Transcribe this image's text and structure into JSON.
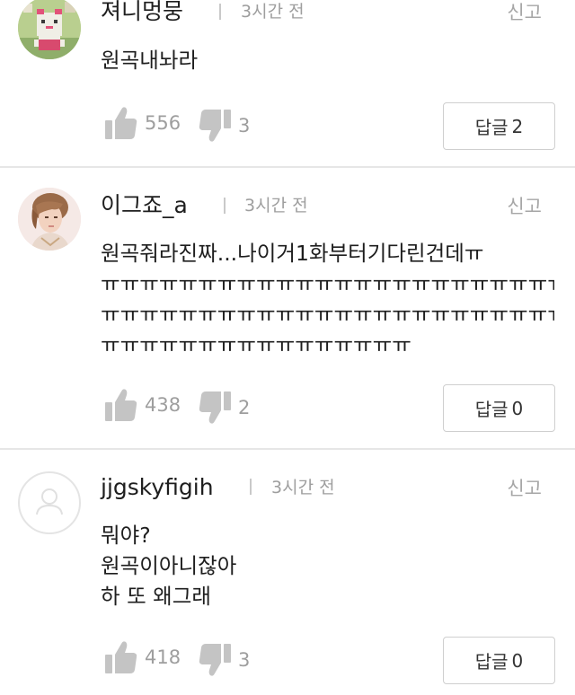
{
  "colors": {
    "text": "#1e1e1e",
    "meta": "#9e9e9e",
    "icon": "#c4c4c4",
    "divider": "#e6e6e6",
    "button_border": "#cfcfcf"
  },
  "comments": [
    {
      "username": "져니멍뭉",
      "time": "3시간 전",
      "report": "신고",
      "lines": [
        "원곡내놔라"
      ],
      "likes": "556",
      "dislikes": "3",
      "reply_label": "답글",
      "reply_count": "2",
      "avatar": "pixel-character-avatar"
    },
    {
      "username": "이그죠_a",
      "time": "3시간 전",
      "report": "신고",
      "lines": [
        "원곡줘라진짜...나이거1화부터기다린건데ㅠ",
        "ㅠㅠㅠㅠㅠㅠㅠㅠㅠㅠㅠㅠㅠㅠㅠㅠㅠㅠㅠㅠㅠㅠㅠㅠㅠㅠㅠㅠㅠㅠ",
        "ㅠㅠㅠㅠㅠㅠㅠㅠㅠㅠㅠㅠㅠㅠㅠㅠㅠㅠㅠㅠㅠㅠㅠㅠㅠㅠㅠㅠㅠㅠ",
        "ㅠㅠㅠㅠㅠㅠㅠㅠㅠㅠㅠㅠㅠㅠㅠㅠ"
      ],
      "likes": "438",
      "dislikes": "2",
      "reply_label": "답글",
      "reply_count": "0",
      "avatar": "person-photo-avatar"
    },
    {
      "username": "jjgskyfigih",
      "time": "3시간 전",
      "report": "신고",
      "lines": [
        "뭐야?",
        "원곡이아니잖아",
        "하 또 왜그래"
      ],
      "likes": "418",
      "dislikes": "3",
      "reply_label": "답글",
      "reply_count": "0",
      "avatar": "default-user-avatar"
    }
  ]
}
